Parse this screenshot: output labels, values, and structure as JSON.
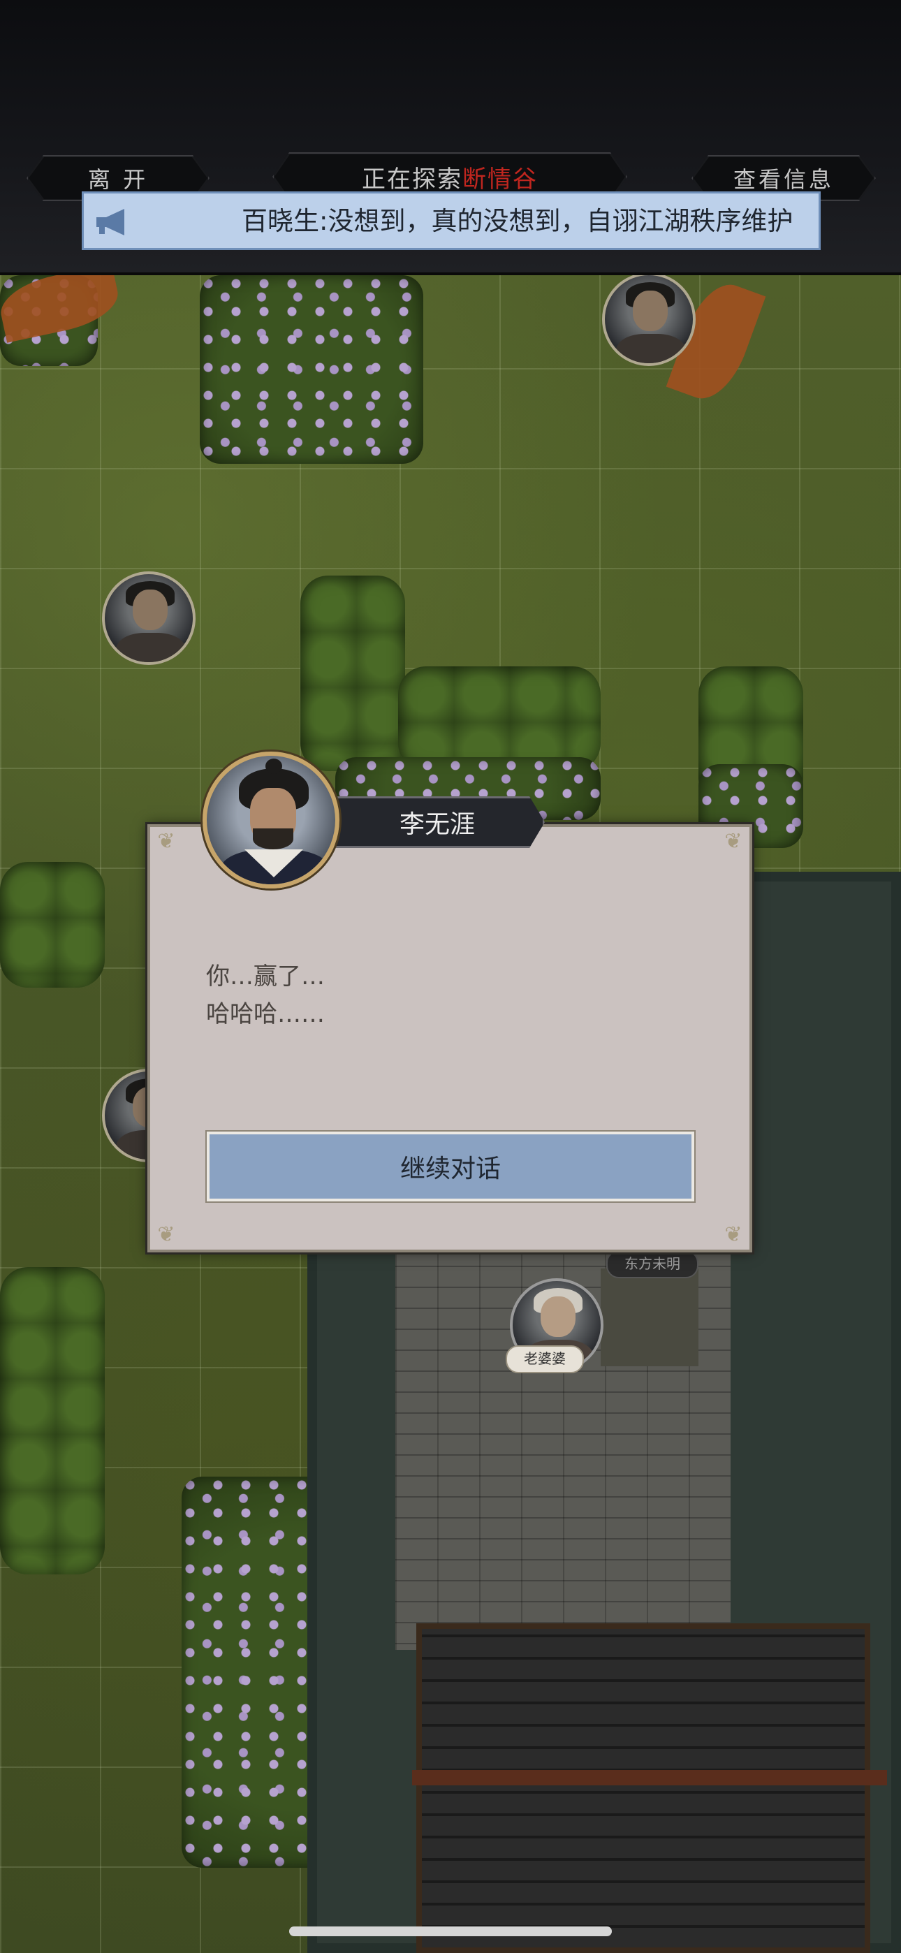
{
  "header": {
    "leave_label": "离  开",
    "explore_prefix": "正在探索",
    "location_name": "断情谷",
    "info_label": "查看信息"
  },
  "announcement": {
    "icon": "megaphone-icon",
    "text": "百晓生:没想到，真的没想到，自诩江湖秩序维护"
  },
  "map": {
    "npc_tags": {
      "old_woman": "老婆婆",
      "top_tag": "东方未明"
    }
  },
  "dialog": {
    "speaker": "李无涯",
    "lines": [
      "你…赢了…",
      "哈哈哈……"
    ],
    "continue_label": "继续对话"
  },
  "colors": {
    "location_accent": "#c0261f",
    "announcement_bg": "#bcd0ea",
    "dialog_bg": "#cbc2c0",
    "button_bg": "#8aa2c2"
  }
}
